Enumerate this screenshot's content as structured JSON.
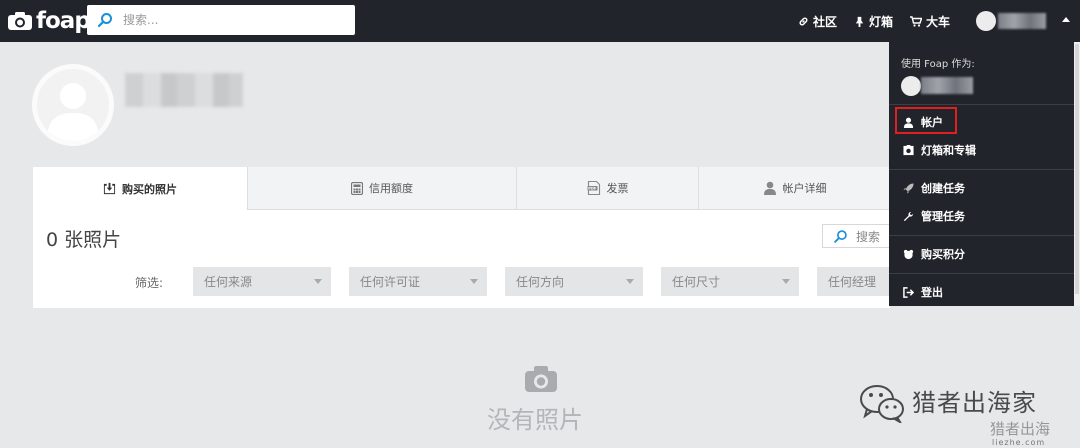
{
  "header": {
    "brand": "foap",
    "search_placeholder": "搜索...",
    "nav": [
      {
        "label": "社区",
        "icon": "link-icon"
      },
      {
        "label": "灯箱",
        "icon": "lightbox-icon"
      },
      {
        "label": "大车",
        "icon": "cart-icon"
      }
    ]
  },
  "profile": {
    "tabs": [
      {
        "label": "购买的照片",
        "icon": "download-photo-icon"
      },
      {
        "label": "信用额度",
        "icon": "calculator-icon"
      },
      {
        "label": "发票",
        "icon": "pdf-icon"
      },
      {
        "label": "帐户详细",
        "icon": "user-icon"
      }
    ],
    "count_label": "0 张照片",
    "search_label": "搜索",
    "filter_label": "筛选:",
    "filters": [
      "任何来源",
      "任何许可证",
      "任何方向",
      "任何尺寸",
      "任何经理"
    ]
  },
  "empty_state": {
    "text": "没有照片"
  },
  "dropdown": {
    "header": "使用 Foap 作为:",
    "items": [
      {
        "label": "帐户",
        "icon": "user-icon"
      },
      {
        "label": "灯箱和专辑",
        "icon": "album-icon"
      },
      {
        "label": "创建任务",
        "icon": "rocket-icon"
      },
      {
        "label": "管理任务",
        "icon": "wrench-icon"
      },
      {
        "label": "购买积分",
        "icon": "coins-icon"
      },
      {
        "label": "登出",
        "icon": "logout-icon"
      }
    ]
  },
  "watermark": {
    "text": "猎者出海家",
    "sub": "猎者出海",
    "url": "liezhe.com"
  },
  "colors": {
    "topbar": "#22242b",
    "page_bg": "#e7e8e9",
    "highlight": "#e02020"
  }
}
